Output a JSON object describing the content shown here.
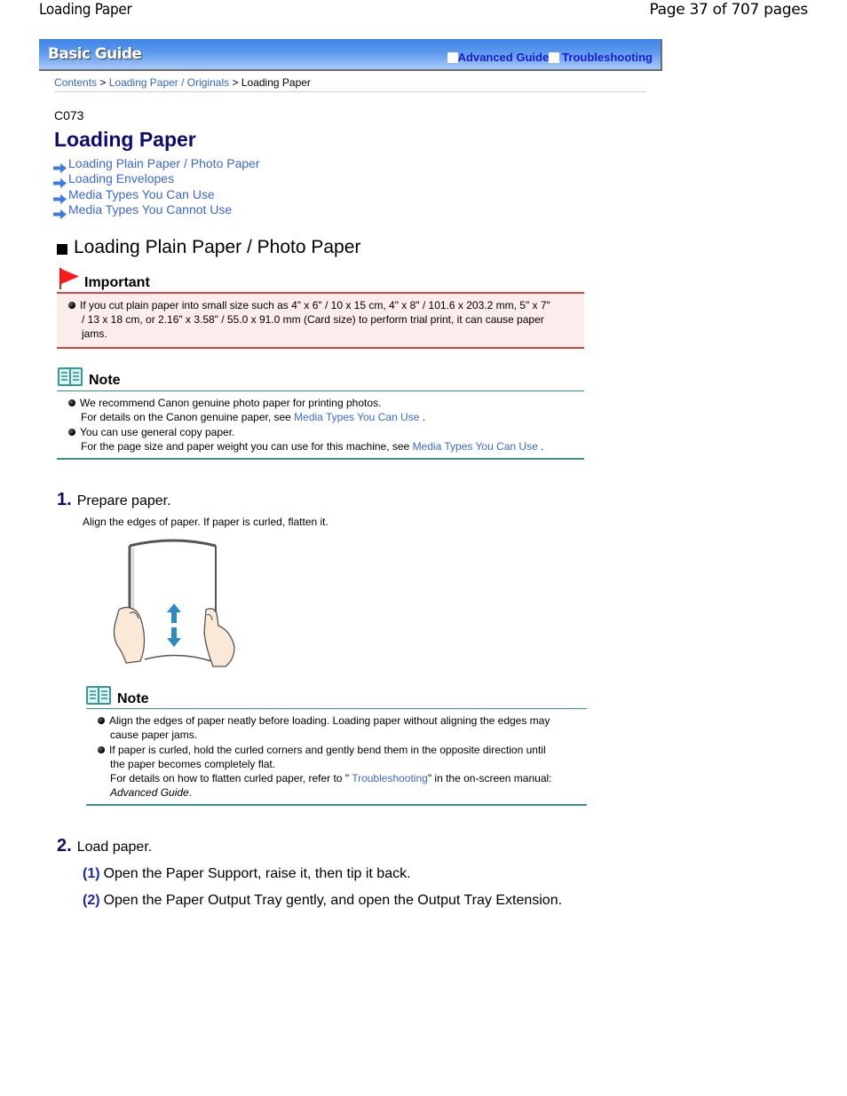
{
  "header": {
    "doc_title": "Loading Paper",
    "page_indicator": "Page 37 of 707 pages"
  },
  "banner": {
    "title": "Basic Guide",
    "links": [
      "Advanced Guide",
      "Troubleshooting"
    ],
    "gradient_top": "#3f83e6",
    "gradient_bottom": "#a8c9f7",
    "link_color": "#1a1acc"
  },
  "breadcrumb": {
    "items": [
      "Contents",
      "Loading Paper / Originals"
    ],
    "separator": ">",
    "current": "Loading Paper"
  },
  "page": {
    "code": "C073",
    "title": "Loading Paper",
    "toc": [
      "Loading Plain Paper / Photo Paper",
      "Loading Envelopes",
      "Media Types You Can Use",
      "Media Types You Cannot Use"
    ]
  },
  "section": {
    "title": "Loading Plain Paper / Photo Paper",
    "important": {
      "label": "Important",
      "items": [
        {
          "line1": "If you cut plain paper into small size such as 4\" x 6\" / 10 x 15 cm, 4\" x 8\" / 101.6 x 203.2 mm, 5\" x 7\"",
          "line2": "/ 13 x 18 cm, or 2.16\" x 3.58\" / 55.0 x 91.0 mm (Card size) to perform trial print, it can cause paper",
          "line3": "jams."
        }
      ]
    },
    "note": {
      "label": "Note",
      "items": [
        {
          "text": "We recommend Canon genuine photo paper for printing photos.",
          "sub_prefix": "For details on the Canon genuine paper, see ",
          "sub_link": "Media Types You Can Use",
          "sub_suffix": "."
        },
        {
          "text": "You can use general copy paper.",
          "sub_prefix": "For the page size and paper weight you can use for this machine, see ",
          "sub_link": "Media Types You Can Use",
          "sub_suffix": "."
        }
      ]
    }
  },
  "steps": [
    {
      "number": "1.",
      "title": "Prepare paper.",
      "description": "Align the edges of paper. If paper is curled, flatten it.",
      "illustration": "hands-aligning-paper-illustration",
      "note": {
        "label": "Note",
        "items": [
          {
            "line1": "Align the edges of paper neatly before loading. Loading paper without aligning the edges may",
            "line2": "cause paper jams."
          },
          {
            "line1": "If paper is curled, hold the curled corners and gently bend them in the opposite direction until",
            "line2": "the paper becomes completely flat.",
            "detail_prefix": "For details on how to flatten curled paper, refer to \" ",
            "detail_link": "Troubleshooting",
            "detail_suffix": "\" in the on-screen manual:",
            "detail_italic": "Advanced Guide",
            "detail_end": "."
          }
        ]
      }
    },
    {
      "number": "2.",
      "title": "Load paper.",
      "substeps": [
        {
          "number": "(1)",
          "text": "Open the Paper Support, raise it, then tip it back."
        },
        {
          "number": "(2)",
          "text": "Open the Paper Output Tray gently, and open the Output Tray Extension."
        }
      ]
    }
  ]
}
